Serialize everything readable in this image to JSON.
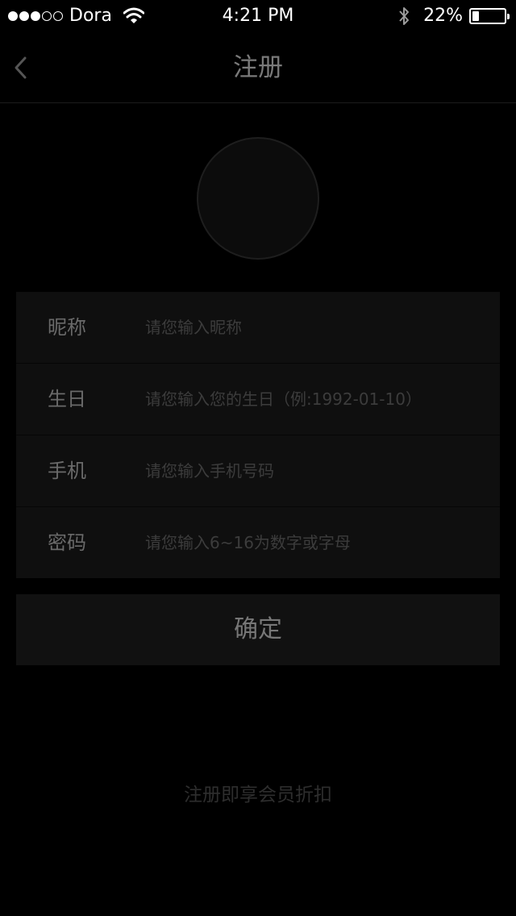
{
  "status_bar": {
    "signal_bars_filled": 3,
    "signal_bars_total": 5,
    "carrier": "Dora",
    "time": "4:21 PM",
    "battery_percent": "22%",
    "battery_level": 0.22,
    "icons": [
      "wifi-icon",
      "bluetooth-icon",
      "battery-icon"
    ]
  },
  "nav": {
    "title": "注册",
    "back_icon": "chevron-left-icon"
  },
  "form": {
    "nickname": {
      "label": "昵称",
      "placeholder": "请您输入昵称",
      "value": ""
    },
    "birthday": {
      "label": "生日",
      "placeholder": "请您输入您的生日（例:1992-01-10）",
      "value": ""
    },
    "phone": {
      "label": "手机",
      "placeholder": "请您输入手机号码",
      "value": ""
    },
    "password": {
      "label": "密码",
      "placeholder": "请您输入6~16为数字或字母",
      "value": ""
    }
  },
  "confirm_button": {
    "label": "确定"
  },
  "footer_note": "注册即享会员折扣",
  "colors": {
    "background": "#000000",
    "panel": "#0f0f0f",
    "label": "#6a6a6a",
    "placeholder": "#3c3c3c",
    "title": "#7a7a7a"
  }
}
